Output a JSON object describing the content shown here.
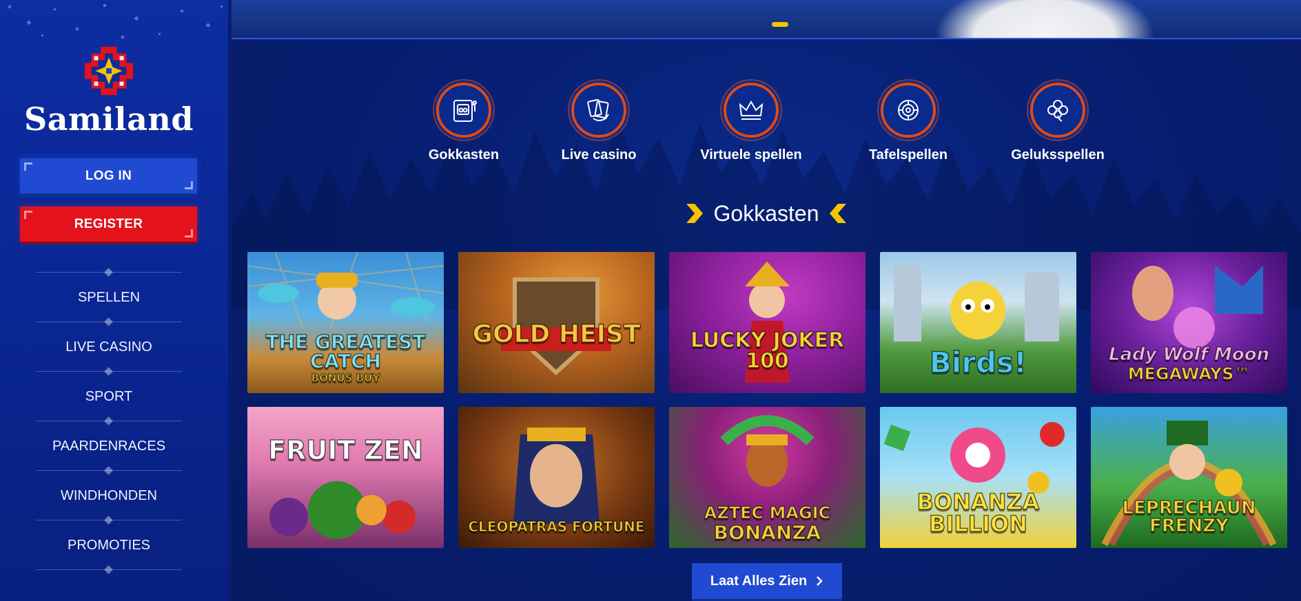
{
  "brand": {
    "name": "Samiland"
  },
  "auth": {
    "login_label": "LOG IN",
    "register_label": "REGISTER"
  },
  "nav": {
    "items": [
      {
        "label": "SPELLEN"
      },
      {
        "label": "LIVE CASINO"
      },
      {
        "label": "SPORT"
      },
      {
        "label": "PAARDENRACES"
      },
      {
        "label": "WINDHONDEN"
      },
      {
        "label": "PROMOTIES"
      }
    ]
  },
  "categories": [
    {
      "label": "Gokkasten",
      "icon": "slot-machine-icon"
    },
    {
      "label": "Live casino",
      "icon": "cards-hand-icon"
    },
    {
      "label": "Virtuele spellen",
      "icon": "crown-icon"
    },
    {
      "label": "Tafelspellen",
      "icon": "roulette-chip-icon"
    },
    {
      "label": "Geluksspellen",
      "icon": "clover-icon"
    }
  ],
  "section": {
    "title": "Gokkasten"
  },
  "games": [
    {
      "title": "THE GREATEST CATCH",
      "subtitle": "BONUS BUY"
    },
    {
      "title": "GOLD HEIST",
      "subtitle": ""
    },
    {
      "title": "LUCKY JOKER 100",
      "subtitle": ""
    },
    {
      "title": "Birds!",
      "subtitle": ""
    },
    {
      "title": "Lady Wolf Moon",
      "subtitle": "MEGAWAYS™"
    },
    {
      "title": "FRUIT ZEN",
      "subtitle": ""
    },
    {
      "title": "CLEOPATRAS FORTUNE",
      "subtitle": ""
    },
    {
      "title": "AZTEC MAGIC",
      "subtitle": "BONANZA"
    },
    {
      "title": "BONANZA BILLION",
      "subtitle": ""
    },
    {
      "title": "LEPRECHAUN FRENZY",
      "subtitle": ""
    }
  ],
  "see_all": {
    "label": "Laat Alles Zien"
  },
  "colors": {
    "accent_blue": "#1f4ad1",
    "register_red": "#e3121b",
    "category_ring": "#e04a12",
    "chevron_yellow": "#f6c400"
  }
}
